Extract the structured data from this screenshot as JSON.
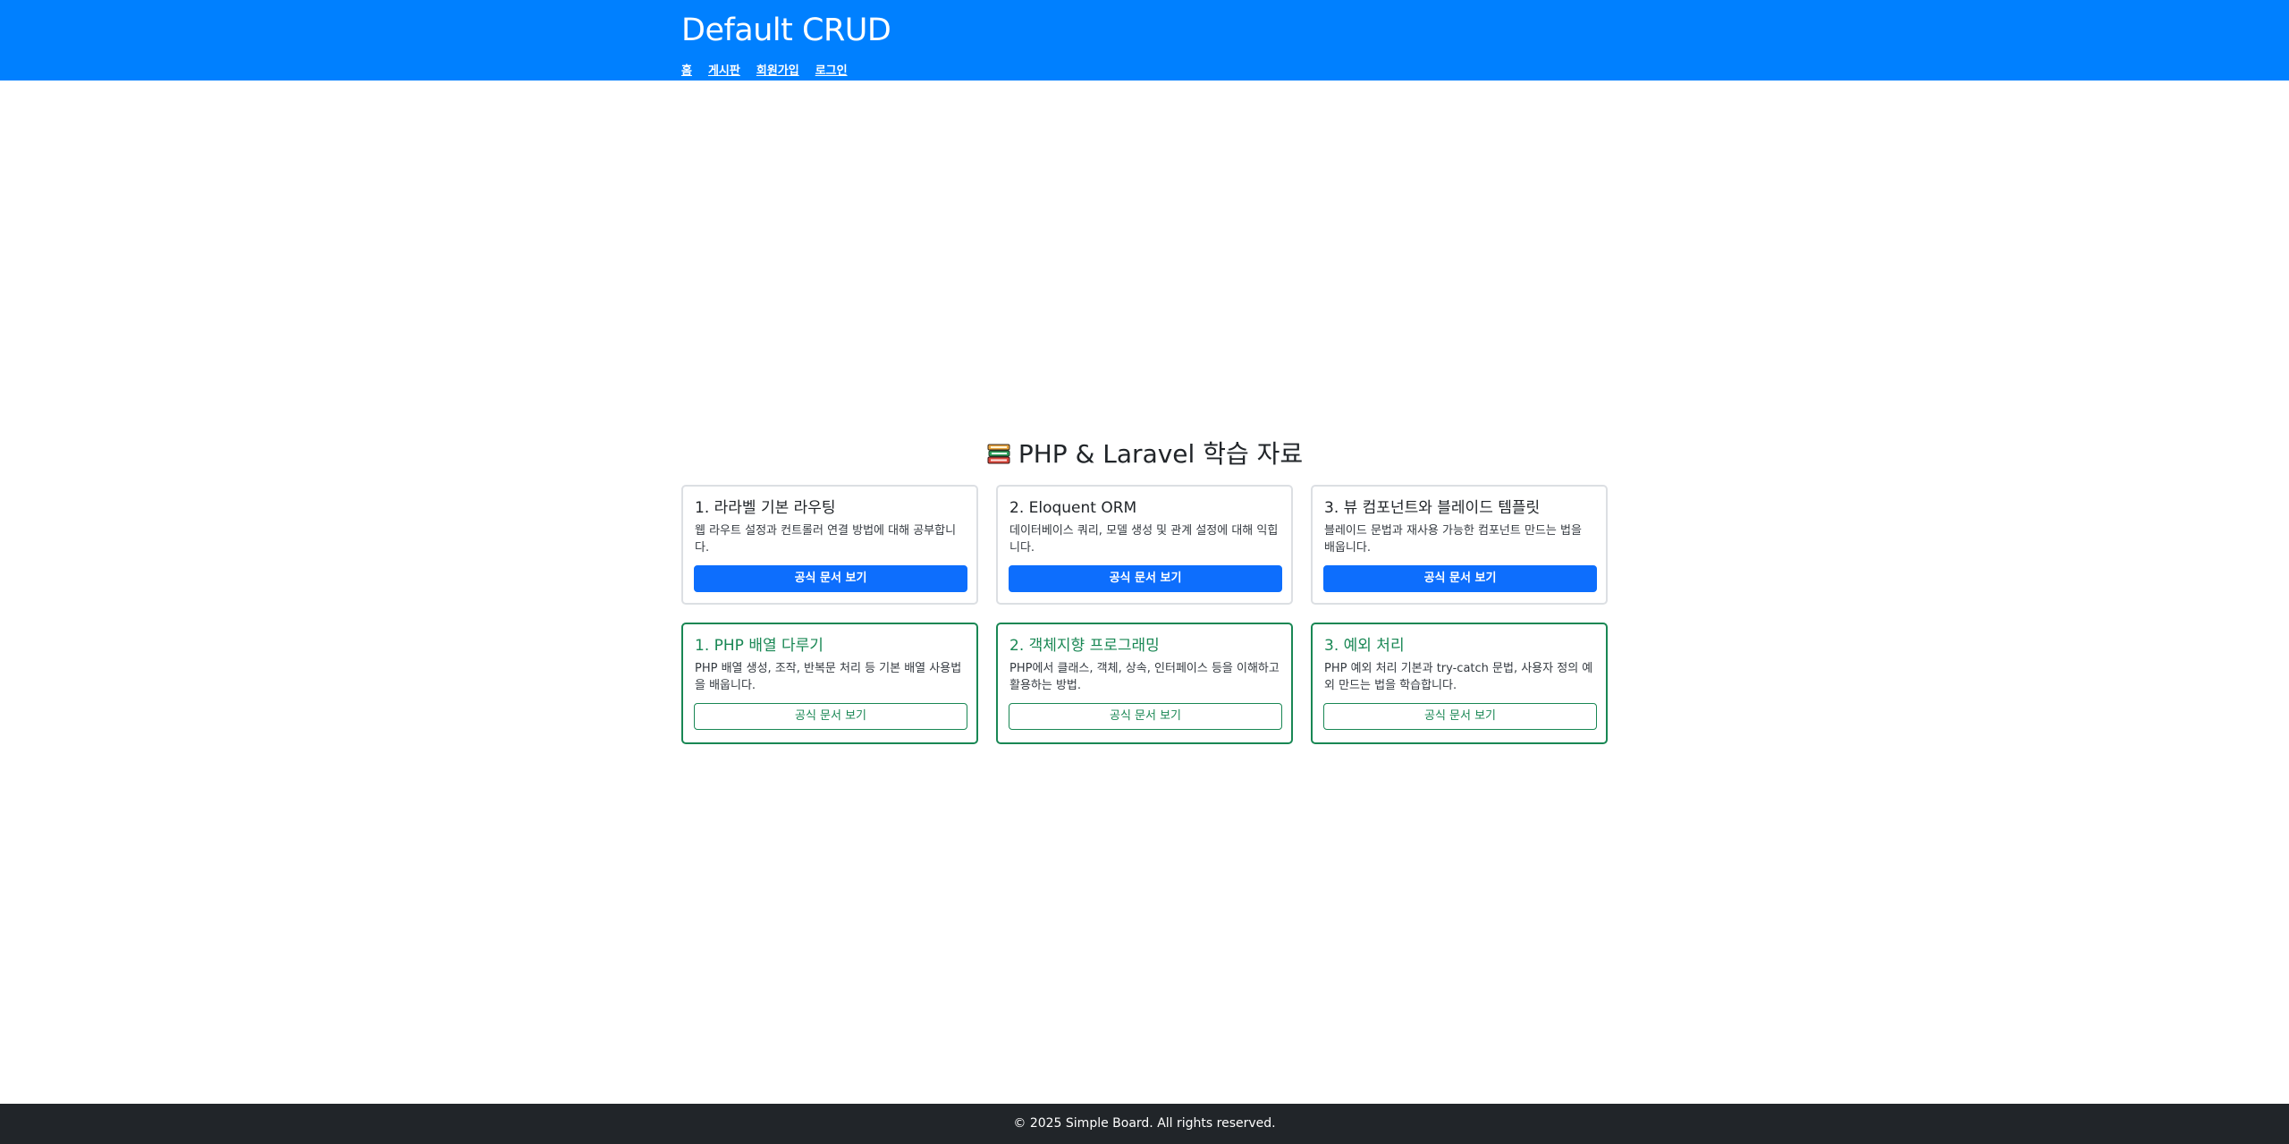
{
  "header": {
    "title": "Default CRUD",
    "nav": [
      "홈",
      "게시판",
      "회원가입",
      "로그인"
    ]
  },
  "section": {
    "icon": "books-icon",
    "title": "PHP & Laravel 학습 자료"
  },
  "laravel_cards": [
    {
      "title": "1. 라라벨 기본 라우팅",
      "text": "웹 라우트 설정과 컨트롤러 연결 방법에 대해 공부합니다.",
      "button": "공식 문서 보기"
    },
    {
      "title": "2. Eloquent ORM",
      "text": "데이터베이스 쿼리, 모델 생성 및 관계 설정에 대해 익힙니다.",
      "button": "공식 문서 보기"
    },
    {
      "title": "3. 뷰 컴포넌트와 블레이드 템플릿",
      "text": "블레이드 문법과 재사용 가능한 컴포넌트 만드는 법을 배웁니다.",
      "button": "공식 문서 보기"
    }
  ],
  "php_cards": [
    {
      "title": "1. PHP 배열 다루기",
      "text": "PHP 배열 생성, 조작, 반복문 처리 등 기본 배열 사용법을 배웁니다.",
      "button": "공식 문서 보기"
    },
    {
      "title": "2. 객체지향 프로그래밍",
      "text": "PHP에서 클래스, 객체, 상속, 인터페이스 등을 이해하고 활용하는 방법.",
      "button": "공식 문서 보기"
    },
    {
      "title": "3. 예외 처리",
      "text": "PHP 예외 처리 기본과 try-catch 문법, 사용자 정의 예외 만드는 법을 학습합니다.",
      "button": "공식 문서 보기"
    }
  ],
  "footer": {
    "text": "© 2025 Simple Board. All rights reserved."
  },
  "colors": {
    "header_bg": "#0080ff",
    "primary": "#0d6efd",
    "success": "#198754",
    "footer_bg": "#212529"
  }
}
